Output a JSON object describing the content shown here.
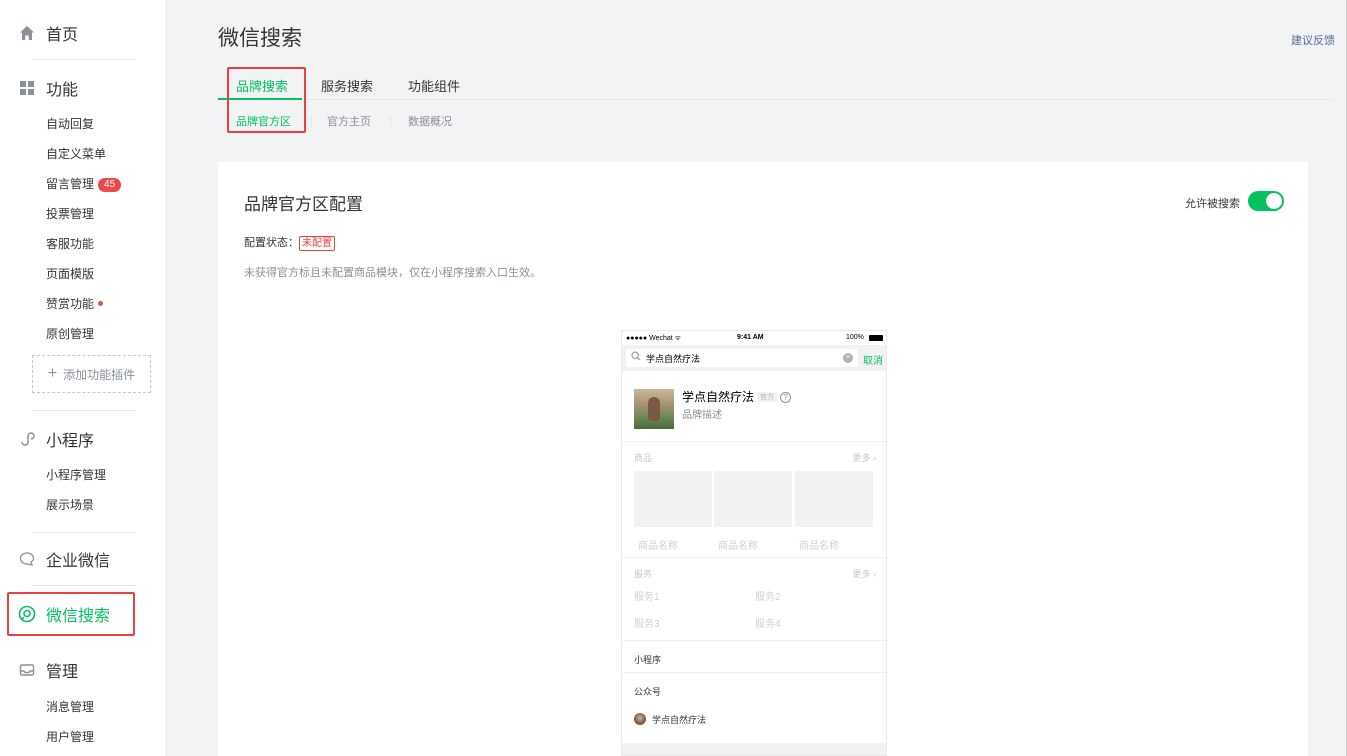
{
  "sidebar": {
    "home": "首页",
    "features": {
      "title": "功能",
      "items": [
        "自动回复",
        "自定义菜单",
        "留言管理",
        "投票管理",
        "客服功能",
        "页面模版",
        "赞赏功能",
        "原创管理"
      ],
      "comment_badge": "45",
      "add_plugin": "添加功能插件"
    },
    "miniprogram": {
      "title": "小程序",
      "items": [
        "小程序管理",
        "展示场景"
      ]
    },
    "wecom": {
      "title": "企业微信"
    },
    "wechat_search": {
      "title": "微信搜索"
    },
    "manage": {
      "title": "管理",
      "items": [
        "消息管理",
        "用户管理"
      ]
    }
  },
  "main": {
    "title": "微信搜索",
    "feedback": "建议反馈",
    "tabs": [
      "品牌搜索",
      "服务搜索",
      "功能组件"
    ],
    "subtabs": [
      "品牌官方区",
      "官方主页",
      "数据概况"
    ],
    "card": {
      "title": "品牌官方区配置",
      "switch_label": "允许被搜索",
      "status_label": "配置状态：",
      "status_value": "未配置",
      "description": "未获得官方标且未配置商品模块，仅在小程序搜索入口生效。"
    }
  },
  "phone": {
    "carrier": "●●●●● Wechat ᯤ",
    "time": "9:41 AM",
    "battery": "100%",
    "search_value": "学点自然疗法",
    "cancel": "取消",
    "brand_name": "学点自然疗法",
    "official_tag": "官方",
    "brand_desc": "品牌描述",
    "products_title": "商品",
    "more": "更多 ›",
    "product_names": [
      "商品名称",
      "商品名称",
      "商品名称"
    ],
    "services_title": "服务",
    "services": [
      "服务1",
      "服务2",
      "服务3",
      "服务4"
    ],
    "miniprogram_label": "小程序",
    "official_account_label": "公众号",
    "account_name": "学点自然疗法"
  },
  "colors": {
    "accent": "#07c160",
    "alert": "#e64340",
    "link": "#576b95"
  }
}
